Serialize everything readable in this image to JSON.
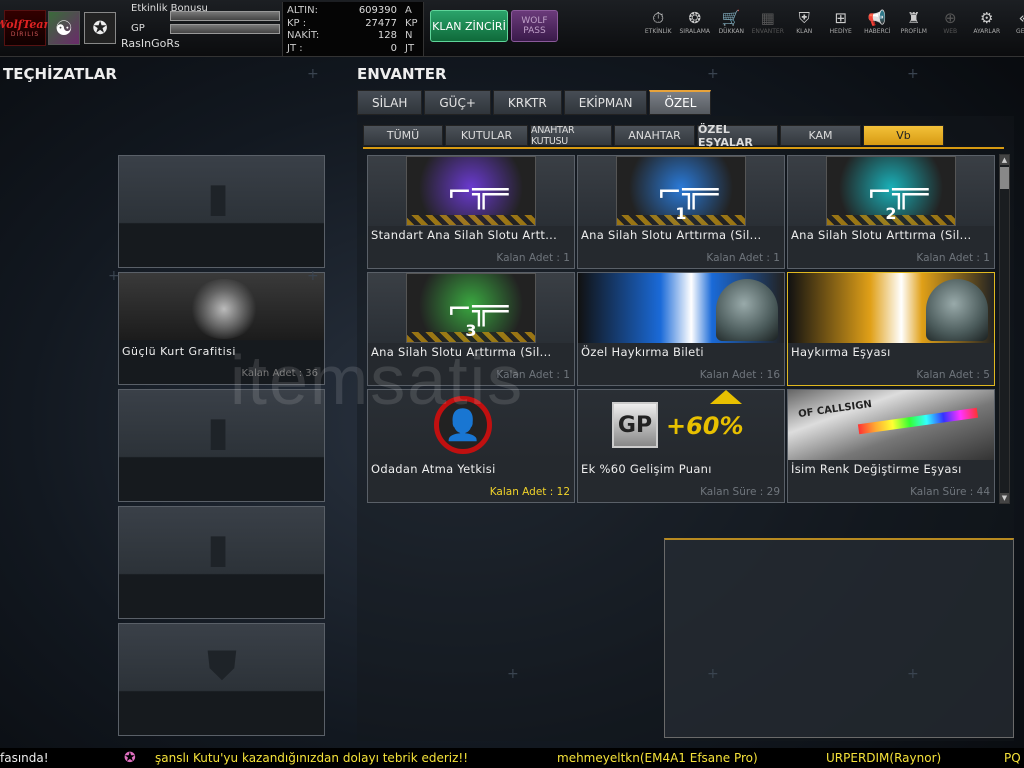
{
  "header": {
    "logo_text": "WolfTeam",
    "logo_sub": "DIRILIS",
    "stats": {
      "event_bonus_label": "Etkinlik Bonusu",
      "gp_label": "GP"
    },
    "username": "RasInGoRs",
    "currency": [
      {
        "label": "ALTIN:",
        "value": "609390",
        "unit": "A"
      },
      {
        "label": "KP   :",
        "value": "27477",
        "unit": "KP"
      },
      {
        "label": "NAKİT:",
        "value": "128",
        "unit": "N"
      },
      {
        "label": "JT   :",
        "value": "0",
        "unit": "JT"
      }
    ],
    "klan_button": "KLAN ZİNCİRİ",
    "wolf_pass_button": "WOLF PASS",
    "nav": [
      {
        "label": "ETKİNLİK",
        "icon": "stopwatch-icon",
        "glyph": "⏱",
        "dim": false
      },
      {
        "label": "SIRALAMA",
        "icon": "medal-icon",
        "glyph": "❂",
        "dim": false
      },
      {
        "label": "DÜKKAN",
        "icon": "cart-icon",
        "glyph": "🛒",
        "dim": false
      },
      {
        "label": "ENVANTER",
        "icon": "inventory-icon",
        "glyph": "▦",
        "dim": true
      },
      {
        "label": "KLAN",
        "icon": "shield-icon",
        "glyph": "⛨",
        "dim": false
      },
      {
        "label": "HEDİYE",
        "icon": "gift-icon",
        "glyph": "⊞",
        "dim": false
      },
      {
        "label": "HABERCİ",
        "icon": "megaphone-icon",
        "glyph": "📢",
        "dim": false
      },
      {
        "label": "PROFİLM",
        "icon": "profile-icon",
        "glyph": "♜",
        "dim": false
      },
      {
        "label": "WEB",
        "icon": "globe-icon",
        "glyph": "⊕",
        "dim": true
      },
      {
        "label": "AYARLAR",
        "icon": "gear-icon",
        "glyph": "⚙",
        "dim": false
      },
      {
        "label": "GERİ",
        "icon": "back-icon",
        "glyph": "«",
        "dim": false
      }
    ]
  },
  "left": {
    "title": "TEÇHİZATLAR",
    "slots": [
      {
        "kind": "empty",
        "icon": "spray-can-icon"
      },
      {
        "kind": "filled",
        "name": "Güçlü Kurt Grafitisi",
        "count_text": "Kalan Adet : 36"
      },
      {
        "kind": "empty",
        "icon": "spray-can-icon"
      },
      {
        "kind": "empty",
        "icon": "spray-can-icon"
      },
      {
        "kind": "empty",
        "icon": "shield-icon"
      }
    ]
  },
  "inventory": {
    "title": "ENVANTER",
    "tabs": [
      {
        "label": "SİLAH",
        "active": false
      },
      {
        "label": "GÜÇ+",
        "active": false
      },
      {
        "label": "KRKTR",
        "active": false
      },
      {
        "label": "EKİPMAN",
        "active": false
      },
      {
        "label": "ÖZEL",
        "active": true
      }
    ],
    "subtabs": [
      {
        "label": "TÜMÜ",
        "w": 80
      },
      {
        "label": "KUTULAR",
        "w": 83
      },
      {
        "label": "ANAHTAR KUTUSU",
        "w": 82
      },
      {
        "label": "ANAHTAR",
        "w": 81
      },
      {
        "label": "ÖZEL EŞYALAR",
        "w": 81
      },
      {
        "label": "KAM",
        "w": 81
      },
      {
        "label": "Vb",
        "w": 81
      }
    ],
    "items": [
      {
        "name": "Standart Ana Silah Slotu Artt...",
        "qty": "Kalan Adet : 1",
        "img": "gun",
        "tint": "#6a3ad0",
        "num": ""
      },
      {
        "name": "Ana Silah Slotu Arttırma (Sil...",
        "qty": "Kalan Adet : 1",
        "img": "gun",
        "tint": "#2a7ad8",
        "num": "1"
      },
      {
        "name": "Ana Silah Slotu Arttırma (Sil...",
        "qty": "Kalan Adet : 1",
        "img": "gun",
        "tint": "#1ab0b8",
        "num": "2"
      },
      {
        "name": "Ana Silah Slotu Arttırma (Sil...",
        "qty": "Kalan Adet : 1",
        "img": "gun",
        "tint": "#3aa840",
        "num": "3"
      },
      {
        "name": "Özel Haykırma Bileti",
        "qty": "Kalan Adet : 16",
        "img": "soldier",
        "tint": "#1a6ad8",
        "num": ""
      },
      {
        "name": "Haykırma Eşyası",
        "qty": "Kalan Adet : 5",
        "img": "soldier",
        "tint": "#e0a018",
        "num": "",
        "gold": true
      },
      {
        "name": "Odadan Atma Yetkisi",
        "qty": "Kalan Adet : 12",
        "img": "kick",
        "tint": "#c01010",
        "num": "",
        "yellow": true
      },
      {
        "name": "Ek %60 Gelişim Puanı",
        "qty": "Kalan Süre : 29",
        "img": "gp",
        "tint": "#e8c000",
        "num": "",
        "gp_badge": "GP",
        "gp_text": "+60%"
      },
      {
        "name": "İsim Renk Değiştirme Eşyası",
        "qty": "Kalan Süre : 44",
        "img": "callsign",
        "tint": "#888",
        "num": "",
        "callsign_text": "OF CALLSIGN"
      }
    ]
  },
  "ticker": [
    {
      "text": "fasında!",
      "color": "#eee"
    },
    {
      "text": "şanslı Kutu'yu kazandığınızdan dolayı tebrik ederiz!!",
      "color": "#f5e23a"
    },
    {
      "text": "mehmeyeltkn(EM4A1 Efsane Pro)",
      "color": "#f5e23a"
    },
    {
      "text": "URPERDIM(Raynor)",
      "color": "#f5e23a"
    },
    {
      "text": "PQ",
      "color": "#f5e23a"
    }
  ],
  "watermark": "itemsatis"
}
